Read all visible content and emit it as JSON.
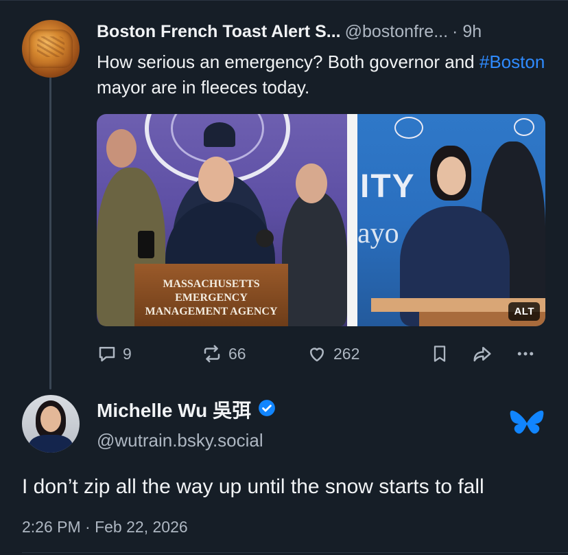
{
  "post1": {
    "author_name": "Boston French Toast Alert S...",
    "handle": "@bostonfre...",
    "time": "· 9h",
    "text_before": "How serious an emergency? Both governor and ",
    "hashtag": "#Boston",
    "text_after": " mayor are in fleeces today.",
    "media": {
      "podium_text": "MASSACHUSETTS\nEMERGENCY\nMANAGEMENT AGENCY",
      "alt_badge": "ALT"
    },
    "actions": {
      "replies": "9",
      "reposts": "66",
      "likes": "262"
    }
  },
  "post2": {
    "author_name": "Michelle Wu 吳弭",
    "handle": "@wutrain.bsky.social",
    "text": "I don’t zip all the way up until the snow starts to fall",
    "meta": "2:26 PM · Feb 22, 2026"
  },
  "colors": {
    "background": "#161e27",
    "accent": "#2f8bff",
    "muted": "#aeb7c2",
    "bluesky": "#1185fe"
  },
  "icons": [
    "reply-icon",
    "repost-icon",
    "like-icon",
    "bookmark-icon",
    "share-icon",
    "more-icon",
    "verified-badge-icon",
    "bluesky-butterfly-icon"
  ]
}
